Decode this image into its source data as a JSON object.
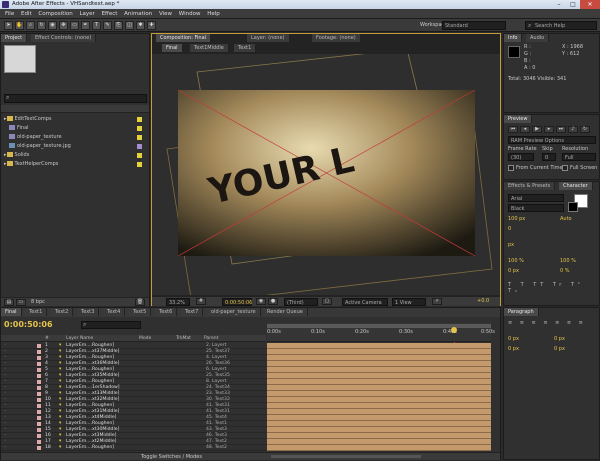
{
  "window": {
    "title": "Adobe After Effects - VHSandtext.aep *"
  },
  "menu": [
    "File",
    "Edit",
    "Composition",
    "Layer",
    "Effect",
    "Animation",
    "View",
    "Window",
    "Help"
  ],
  "toolbar": {
    "workspace_label": "Workspace:",
    "workspace_value": "Standard",
    "search_placeholder": "Search Help"
  },
  "project": {
    "tab": "Project",
    "effect_controls_tab": "Effect Controls: (none)",
    "items": [
      {
        "name": "EditTextComps",
        "type": "folder",
        "color": "#e8d23a"
      },
      {
        "name": "Final",
        "type": "comp",
        "color": "#e8d23a"
      },
      {
        "name": "old-paper_texture",
        "type": "comp",
        "color": "#e8d23a"
      },
      {
        "name": "old-paper_texture.jpg",
        "type": "image",
        "color": "#a58ad6"
      },
      {
        "name": "Solids",
        "type": "folder",
        "color": "#e8d23a"
      },
      {
        "name": "TextHelperComps",
        "type": "folder",
        "color": "#e8d23a"
      }
    ],
    "bpc": "8 bpc"
  },
  "comp_panel": {
    "tabs": [
      "Composition: Final",
      "Layer: (none)",
      "Footage: (none)"
    ],
    "breadcrumbs": [
      "Final",
      "Text1Middle",
      "Text1"
    ],
    "preview_text": "YOUR L",
    "footer": {
      "zoom": "33.2%",
      "timecode": "0:00:50:06",
      "resolution": "(Third)",
      "camera": "Active Camera",
      "views": "1 View",
      "offset": "+0.0"
    }
  },
  "info": {
    "tabs": [
      "Info",
      "Audio"
    ],
    "r": "R :",
    "g": "G :",
    "b": "B :",
    "a": "A : 0",
    "x": "X : 1968",
    "y": "Y : 612",
    "total": "Total: 3046  Visible: 341"
  },
  "preview": {
    "tab": "Preview",
    "ram_options": "RAM Preview Options",
    "frame_rate_label": "Frame Rate",
    "skip_label": "Skip",
    "resolution_label": "Resolution",
    "frame_rate": "(30)",
    "skip": "0",
    "resolution": "Full",
    "from_current": "From Current Time",
    "full_screen": "Full Screen"
  },
  "character": {
    "tabs": [
      "Effects & Presets",
      "Character"
    ],
    "font": "Arial",
    "style": "Black",
    "size": "100 px",
    "auto": "Auto",
    "kerning": "0",
    "unit_px": "px",
    "scale_v": "100 %",
    "scale_h": "100 %",
    "baseline": "0 px",
    "tsume": "0 %"
  },
  "paragraph": {
    "tab": "Paragraph",
    "indent_left": "0 px",
    "indent_right": "0 px",
    "space_before": "0 px",
    "space_after": "0 px"
  },
  "timeline": {
    "tabs": [
      "Final",
      "Text1",
      "Text2",
      "Text3",
      "Text4",
      "Text5",
      "Text6",
      "Text7",
      "old-paper_texture",
      "Render Queue"
    ],
    "timecode": "0:00:50:06",
    "headers": {
      "num": "#",
      "name": "Layer Name",
      "mode": "Mode",
      "trkmat": "TrkMat",
      "parent": "Parent"
    },
    "ruler": [
      "0:00s",
      "0:10s",
      "0:20s",
      "0:30s",
      "0:40s",
      "0:50s"
    ],
    "toggle_label": "Toggle Switches / Modes",
    "layers": [
      {
        "n": "1",
        "name": "LayerEm....Roughen]",
        "parent": "2. Layert"
      },
      {
        "n": "2",
        "name": "LayerEm....xt37Middle]",
        "parent": "25. Text37"
      },
      {
        "n": "3",
        "name": "LayerEm....Roughen]",
        "parent": "4. Layert"
      },
      {
        "n": "4",
        "name": "LayerEm....xt36Middle]",
        "parent": "26. Text36"
      },
      {
        "n": "5",
        "name": "LayerEm....Roughen]",
        "parent": "6. Layert"
      },
      {
        "n": "6",
        "name": "LayerEm....xt35Middle]",
        "parent": "25. Text35"
      },
      {
        "n": "7",
        "name": "LayerEm....Roughen]",
        "parent": "8. Layert"
      },
      {
        "n": "8",
        "name": "LayerEm....1erShadow]",
        "parent": "24. Text34"
      },
      {
        "n": "9",
        "name": "LayerEm....xt33Middle]",
        "parent": "23. Text33"
      },
      {
        "n": "10",
        "name": "LayerEm....xt32Middle]",
        "parent": "30. Text32"
      },
      {
        "n": "11",
        "name": "LayerEm....Roughen]",
        "parent": "41. Text31"
      },
      {
        "n": "12",
        "name": "LayerEm....xt31Middle]",
        "parent": "41. Text31"
      },
      {
        "n": "13",
        "name": "LayerEm....xt4Middle]",
        "parent": "45. Text4"
      },
      {
        "n": "14",
        "name": "LayerEm....Roughen]",
        "parent": "41. Text1"
      },
      {
        "n": "15",
        "name": "LayerEm....xt30Middle]",
        "parent": "43. Text3"
      },
      {
        "n": "16",
        "name": "LayerEm....xt3Middle]",
        "parent": "46. Text3"
      },
      {
        "n": "17",
        "name": "LayerEm....xt2Middle]",
        "parent": "47. Text2"
      },
      {
        "n": "18",
        "name": "LayerEm....Roughen]",
        "parent": "48. Text2"
      }
    ]
  },
  "colors": {
    "label_swatch": "#e2a8a8",
    "bar": "#c49a6c",
    "playhead": "#d13a3a"
  }
}
